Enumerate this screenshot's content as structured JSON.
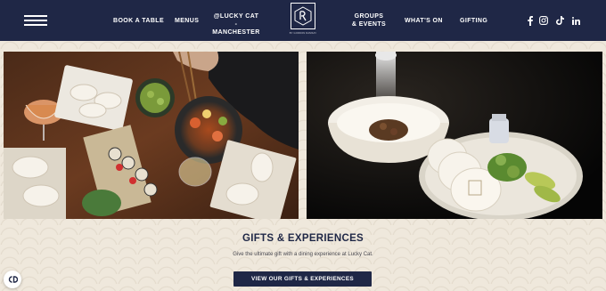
{
  "nav": {
    "menu_icon": "hamburger-menu-icon",
    "links": [
      "BOOK A TABLE",
      "MENUS",
      "@LUCKY CAT - MANCHESTER",
      "GROUPS & EVENTS",
      "WHAT'S ON",
      "GIFTING"
    ],
    "logo_caption": "BY GORDON RAMSAY",
    "social_icons": [
      "facebook-icon",
      "instagram-icon",
      "tiktok-icon",
      "linkedin-icon"
    ],
    "colors": {
      "background": "#1f2746",
      "text": "#ffffff"
    }
  },
  "gallery": {
    "left_image": "asian-dining-spread-photo",
    "right_image": "bao-buns-and-dish-photo"
  },
  "section": {
    "title": "GIFTS & EXPERIENCES",
    "subtitle": "Give the ultimate gift with a dining experience at Lucky Cat.",
    "cta_label": "VIEW OUR GIFTS & EXPERIENCES"
  },
  "cookie": {
    "icon": "cookie-settings-icon"
  },
  "colors": {
    "page_bg": "#efe8dc",
    "accent": "#1f2746"
  }
}
